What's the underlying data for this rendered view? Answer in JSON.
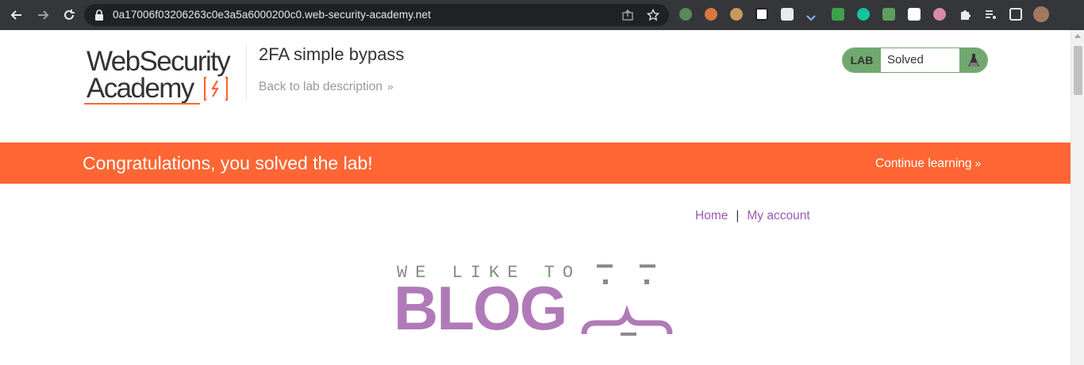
{
  "browser": {
    "url": "0a17006f03206263c0e3a5a6000200c0.web-security-academy.net",
    "icons": [
      "back-icon",
      "forward-icon",
      "reload-icon",
      "lock-icon",
      "share-icon",
      "bookmark-star-icon"
    ],
    "extensions": [
      "ext-green-icon",
      "ext-orange-icon",
      "ext-cookie-icon",
      "ext-notion-icon",
      "ext-shield-icon",
      "ext-chevron-icon",
      "ext-ublock-icon",
      "ext-grammarly-icon",
      "ext-keyboard-icon",
      "ext-b-icon",
      "ext-globe-icon",
      "puzzle-icon",
      "playlist-icon",
      "sidepanel-icon",
      "profile-avatar"
    ]
  },
  "header": {
    "logo_line1": "WebSecurity",
    "logo_line2": "Academy",
    "lab_title": "2FA simple bypass",
    "back_link": "Back to lab description",
    "back_chevron": "»",
    "lab_tag": "LAB",
    "lab_status": "Solved"
  },
  "banner": {
    "message": "Congratulations, you solved the lab!",
    "continue": "Continue learning",
    "continue_chevron": "»"
  },
  "nav": {
    "home": "Home",
    "separator": "|",
    "account": "My account"
  },
  "blog_logo": {
    "tagline": "WE LIKE TO",
    "word": "BLOG"
  },
  "colors": {
    "brand_orange": "#ff6633",
    "lab_green": "#70a86f",
    "link_purple": "#9b59b6",
    "blog_purple": "#b07ab8",
    "chrome_bg": "#35363a"
  }
}
